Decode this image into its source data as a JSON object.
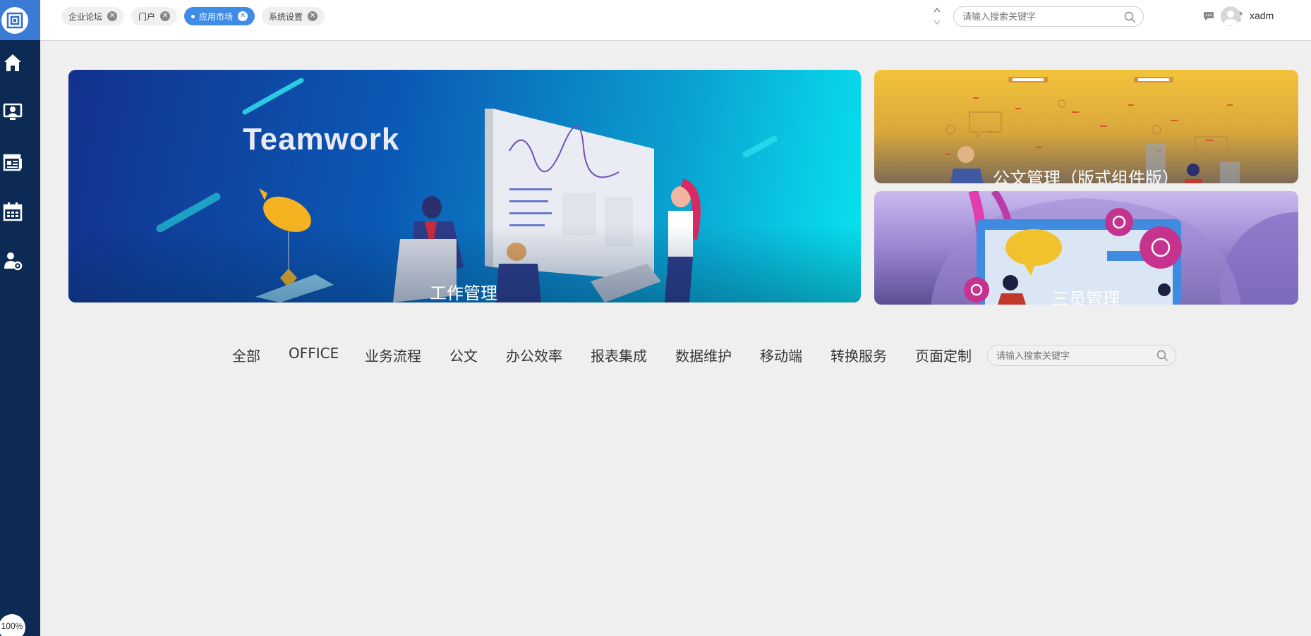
{
  "sidebar": {
    "zoom": "100%",
    "icons": [
      "home-icon",
      "monitor-user-icon",
      "news-icon",
      "calendar-icon",
      "user-settings-icon"
    ]
  },
  "tabs": [
    {
      "label": "企业论坛",
      "active": false
    },
    {
      "label": "门户",
      "active": false
    },
    {
      "label": "应用市场",
      "active": true
    },
    {
      "label": "系统设置",
      "active": false
    }
  ],
  "header": {
    "search_placeholder": "请输入搜索关键字",
    "username": "xadm"
  },
  "banners": {
    "main": {
      "word": "Teamwork",
      "title": "工作管理"
    },
    "right_top": {
      "title": "公文管理（版式组件版）"
    },
    "right_bottom": {
      "title": "三员管理"
    }
  },
  "categories": [
    "全部",
    "OFFICE",
    "业务流程",
    "公文",
    "办公效率",
    "报表集成",
    "数据维护",
    "移动端",
    "转换服务",
    "页面定制"
  ],
  "category_search_placeholder": "请输入搜索关键字",
  "colors": {
    "sidebar": "#0c2a54",
    "accent": "#3e8ce6",
    "background": "#efefef"
  }
}
